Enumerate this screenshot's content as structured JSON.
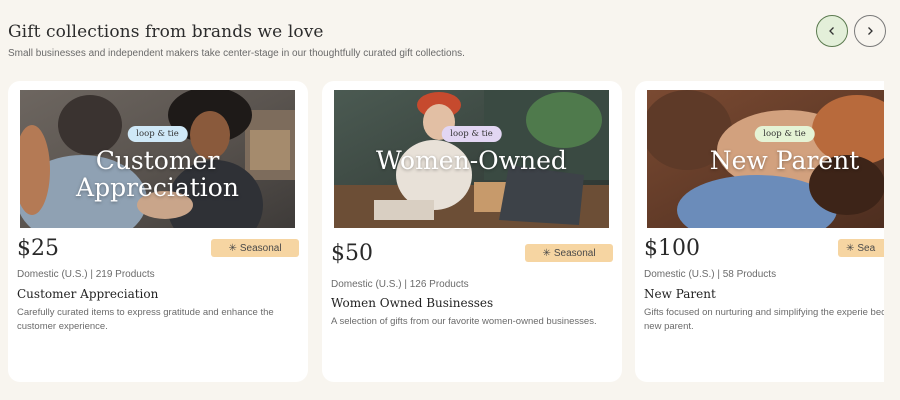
{
  "header": {
    "title": "Gift collections from brands we love",
    "subtitle": "Small businesses and independent makers take center-stage in our thoughtfully curated gift collections."
  },
  "nav": {
    "prev_icon": "chevron-left-icon",
    "next_icon": "chevron-right-icon"
  },
  "cards": [
    {
      "brand": "loop & tie",
      "overlay_line1": "Customer",
      "overlay_line2": "Appreciation",
      "price": "$25",
      "badge": "Seasonal",
      "meta": "Domestic (U.S.) | 219 Products",
      "name": "Customer Appreciation",
      "description": "Carefully curated items to express gratitude and enhance the customer experience."
    },
    {
      "brand": "loop & tie",
      "overlay_line1": "Women-Owned",
      "price": "$50",
      "badge": "Seasonal",
      "meta": "Domestic (U.S.) | 126 Products",
      "name": "Women Owned Businesses",
      "description": "A selection of gifts from our favorite women-owned businesses."
    },
    {
      "brand": "loop & tie",
      "overlay_line1": "New Parent",
      "price": "$100",
      "badge": "Sea",
      "meta": "Domestic (U.S.) | 58 Products",
      "name": "New Parent",
      "description": "Gifts focused on nurturing and simplifying the experie becoming a new parent."
    }
  ],
  "colors": {
    "page_bg": "#f8f5ef",
    "badge_bg": "#f6d5a2",
    "brand_pill_1": "#cfe8f7",
    "brand_pill_2": "#e2d6f3",
    "brand_pill_3": "#e5f3d5",
    "nav_prev_bg": "#e3efd9"
  }
}
